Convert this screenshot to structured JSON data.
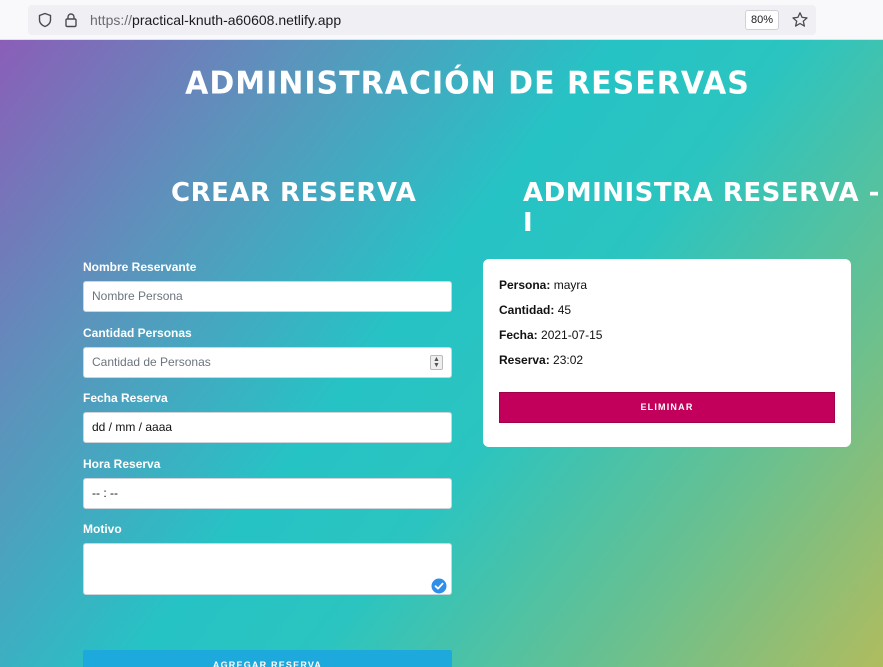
{
  "browser": {
    "url_protocol": "https://",
    "url_host": "practical-knuth-a60608.netlify.app",
    "zoom": "80%"
  },
  "page": {
    "title": "ADMINISTRACIÓN DE RESERVAS"
  },
  "create": {
    "title": "CREAR RESERVA",
    "fields": {
      "nombre": {
        "label": "Nombre Reservante",
        "placeholder": "Nombre Persona"
      },
      "cantidad": {
        "label": "Cantidad Personas",
        "placeholder": "Cantidad de Personas"
      },
      "fecha": {
        "label": "Fecha Reserva",
        "value": "dd / mm / aaaa"
      },
      "hora": {
        "label": "Hora Reserva",
        "value": "-- : --"
      },
      "motivo": {
        "label": "Motivo"
      }
    },
    "submit_label": "AGREGAR RESERVA"
  },
  "admin": {
    "title": "ADMINISTRA RESERVA - I",
    "card": {
      "persona_label": "Persona:",
      "persona": "mayra",
      "cantidad_label": "Cantidad:",
      "cantidad": "45",
      "fecha_label": "Fecha:",
      "fecha": "2021-07-15",
      "reserva_label": "Reserva:",
      "reserva": "23:02"
    },
    "delete_label": "ELIMINAR"
  },
  "icons": [
    "shield-icon",
    "lock-icon",
    "star-icon",
    "stepper-icon",
    "checkmark-badge-icon"
  ],
  "colors": {
    "submit": "#1ea9dc",
    "delete": "#c2005b"
  }
}
